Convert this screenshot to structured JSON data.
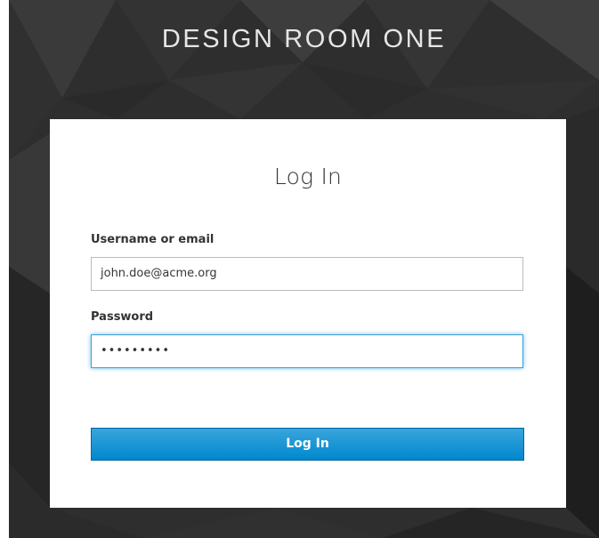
{
  "header": {
    "brand_text": "DESIGN ROOM ONE"
  },
  "login_card": {
    "title": "Log In",
    "username": {
      "label": "Username or email",
      "value": "john.doe@acme.org"
    },
    "password": {
      "label": "Password",
      "masked_value": "•••••••••"
    },
    "submit_label": "Log In"
  },
  "colors": {
    "background": "#2c2c2c",
    "card": "#ffffff",
    "accent": "#0088ce",
    "focus_border": "#3a9fd6",
    "text": "#363636"
  }
}
